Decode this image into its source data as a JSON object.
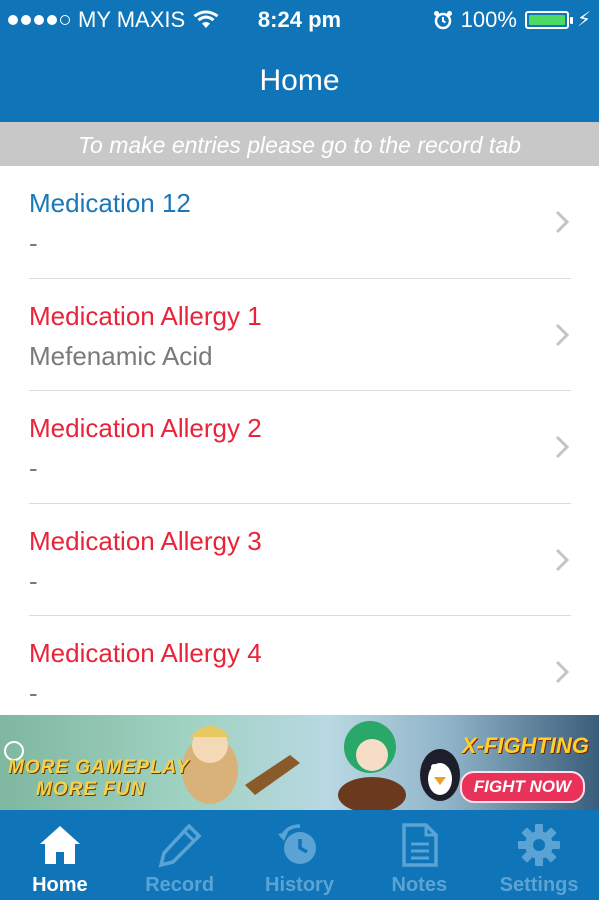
{
  "status_bar": {
    "carrier": "MY MAXIS",
    "time": "8:24 pm",
    "battery": "100%",
    "signal_bars_filled": 4,
    "signal_bars_total": 5
  },
  "nav": {
    "title": "Home"
  },
  "notice": "To make entries please go to the record tab",
  "list": [
    {
      "title": "Medication 12",
      "subtitle": "-",
      "color": "#1a78b8"
    },
    {
      "title": "Medication Allergy 1",
      "subtitle": "Mefenamic Acid",
      "color": "#e8243a"
    },
    {
      "title": "Medication Allergy 2",
      "subtitle": "-",
      "color": "#e8243a"
    },
    {
      "title": "Medication Allergy 3",
      "subtitle": "-",
      "color": "#e8243a"
    },
    {
      "title": "Medication Allergy 4",
      "subtitle": "-",
      "color": "#e8243a"
    }
  ],
  "ad": {
    "line1": "MORE GAMEPLAY",
    "line2": "MORE FUN",
    "brand": "X-FIGHTING",
    "cta": "FIGHT NOW"
  },
  "tabs": [
    {
      "label": "Home",
      "icon": "home-icon",
      "active": true
    },
    {
      "label": "Record",
      "icon": "pencil-icon",
      "active": false
    },
    {
      "label": "History",
      "icon": "history-icon",
      "active": false
    },
    {
      "label": "Notes",
      "icon": "notes-icon",
      "active": false
    },
    {
      "label": "Settings",
      "icon": "gear-icon",
      "active": false
    }
  ],
  "colors": {
    "brand_blue": "#0f75b8",
    "tab_inactive": "#5aa3d4",
    "medication_title": "#1a78b8",
    "allergy_title": "#e8243a",
    "battery_green": "#4cd964"
  }
}
